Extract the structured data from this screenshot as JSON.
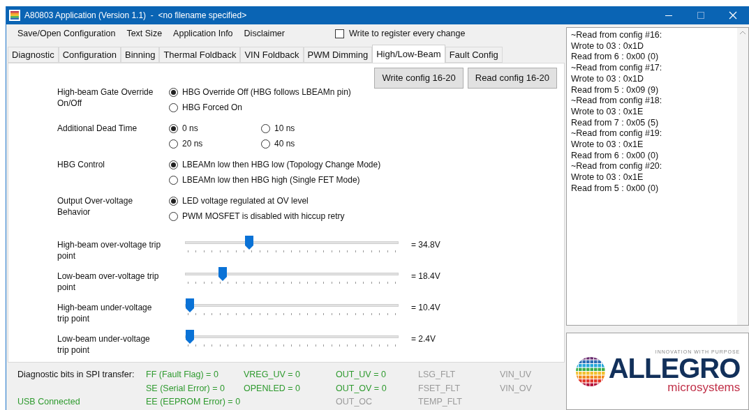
{
  "window": {
    "title": "A80803 Application (Version 1.1)  -  <no filename specified>"
  },
  "menu": [
    "Save/Open Configuration",
    "Text Size",
    "Application Info",
    "Disclaimer"
  ],
  "write_every_change": {
    "label": "Write to register every change",
    "checked": false
  },
  "tabs": [
    {
      "label": "Diagnostic",
      "selected": false
    },
    {
      "label": "Configuration",
      "selected": false
    },
    {
      "label": "Binning",
      "selected": false
    },
    {
      "label": "Thermal Foldback",
      "selected": false
    },
    {
      "label": "VIN Foldback",
      "selected": false
    },
    {
      "label": "PWM Dimming",
      "selected": false
    },
    {
      "label": "High/Low-Beam",
      "selected": true
    },
    {
      "label": "Fault Config",
      "selected": false
    }
  ],
  "buttons": [
    "Write config 16-20",
    "Read config 16-20"
  ],
  "radio_groups": [
    {
      "label": "High-beam Gate Override On/Off",
      "kind": "list",
      "options": [
        {
          "label": "HBG Override Off (HBG follows LBEAMn pin)",
          "selected": true
        },
        {
          "label": "HBG Forced On",
          "selected": false
        }
      ]
    },
    {
      "label": "Additional Dead Time",
      "kind": "grid",
      "options": [
        {
          "label": "0 ns",
          "selected": true
        },
        {
          "label": "10 ns",
          "selected": false
        },
        {
          "label": "20 ns",
          "selected": false
        },
        {
          "label": "40 ns",
          "selected": false
        }
      ]
    },
    {
      "label": "HBG Control",
      "kind": "list",
      "options": [
        {
          "label": "LBEAMn low then HBG low (Topology Change Mode)",
          "selected": true
        },
        {
          "label": "LBEAMn low then HBG high (Single FET Mode)",
          "selected": false
        }
      ]
    },
    {
      "label": "Output Over-voltage Behavior",
      "kind": "list",
      "options": [
        {
          "label": "LED voltage regulated at OV level",
          "selected": true
        },
        {
          "label": "PWM MOSFET is disabled with hiccup retry",
          "selected": false
        }
      ]
    }
  ],
  "sliders": [
    {
      "label": "High-beam over-voltage trip point",
      "level": 0.29,
      "reading": "= 34.8V"
    },
    {
      "label": "Low-beam over-voltage trip point",
      "level": 0.16,
      "reading": "= 18.4V"
    },
    {
      "label": "High-beam under-voltage trip point",
      "level": 0,
      "reading": "= 10.4V"
    },
    {
      "label": "Low-beam under-voltage trip point",
      "level": 0,
      "reading": "= 2.4V"
    }
  ],
  "diagnostics": {
    "label": "Diagnostic bits in SPI transfer:",
    "columns": [
      [
        {
          "text": "FF (Fault Flag) = 0",
          "active": true
        },
        {
          "text": "SE (Serial Error) = 0",
          "active": true
        },
        {
          "text": "EE (EEPROM Error) = 0",
          "active": true
        }
      ],
      [
        {
          "text": "VREG_UV = 0",
          "active": true
        },
        {
          "text": "OPENLED = 0",
          "active": true
        }
      ],
      [
        {
          "text": "OUT_UV = 0",
          "active": true
        },
        {
          "text": "OUT_OV = 0",
          "active": true
        },
        {
          "text": "OUT_OC",
          "active": false
        }
      ],
      [
        {
          "text": "LSG_FLT",
          "active": false
        },
        {
          "text": "FSET_FLT",
          "active": false
        },
        {
          "text": "TEMP_FLT",
          "active": false
        }
      ],
      [
        {
          "text": "VIN_UV",
          "active": false
        },
        {
          "text": "VIN_OV",
          "active": false
        }
      ]
    ]
  },
  "usb_status": {
    "text": "USB Connected",
    "active": true
  },
  "log": [
    "~Read from config #16:",
    "Wrote to 03 : 0x1D",
    "Read from 6 : 0x00 (0)",
    "~Read from config #17:",
    "Wrote to 03 : 0x1D",
    "Read from 5 : 0x09 (9)",
    "~Read from config #18:",
    "Wrote to 03 : 0x1E",
    "Read from 7 : 0x05 (5)",
    "~Read from config #19:",
    "Wrote to 03 : 0x1E",
    "Read from 6 : 0x00 (0)",
    "~Read from config #20:",
    "Wrote to 03 : 0x1E",
    "Read from 5 : 0x00 (0)"
  ],
  "logo": {
    "tagline": "INNOVATION WITH PURPOSE",
    "name": "ALLEGRO",
    "sub": "microsystems"
  }
}
